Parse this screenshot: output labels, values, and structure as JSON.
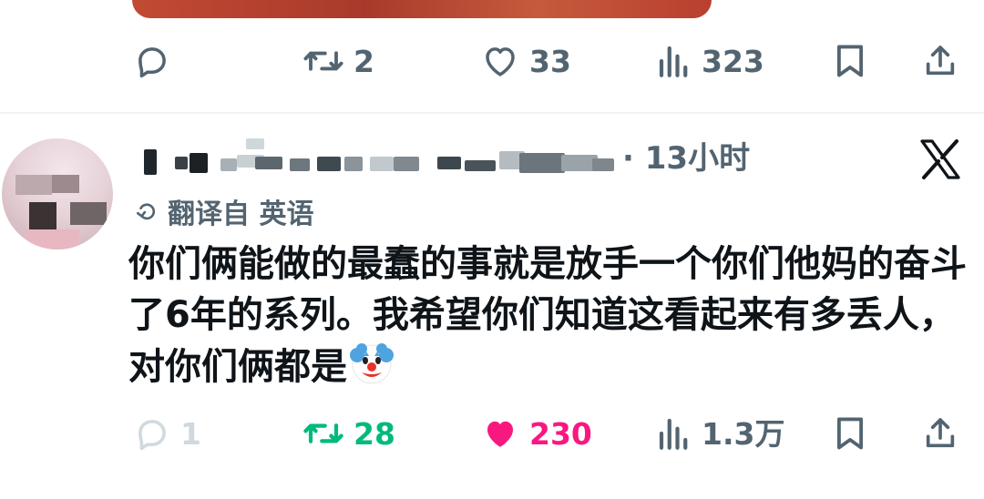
{
  "prev_tweet": {
    "actions": {
      "reply_count": "",
      "retweet_count": "2",
      "like_count": "33",
      "views_count": "323"
    }
  },
  "reply_tweet": {
    "time": "· 13小时",
    "translated_label": "翻译自 英语",
    "text": "你们俩能做的最蠢的事就是放手一个你们他妈的奋斗了6年的系列。我希望你们知道这看起来有多丢人，对你们俩都是",
    "emoji": "clown-face",
    "actions": {
      "reply_count": "1",
      "retweet_count": "28",
      "like_count": "230",
      "views_count": "1.3万"
    }
  },
  "colors": {
    "muted": "#536471",
    "retweeted": "#00ba7c",
    "liked": "#f91880",
    "text": "#0f1419"
  },
  "icons": [
    "reply-icon",
    "retweet-icon",
    "like-icon",
    "views-icon",
    "bookmark-icon",
    "share-icon",
    "x-logo-icon",
    "translate-icon",
    "clown-emoji"
  ]
}
